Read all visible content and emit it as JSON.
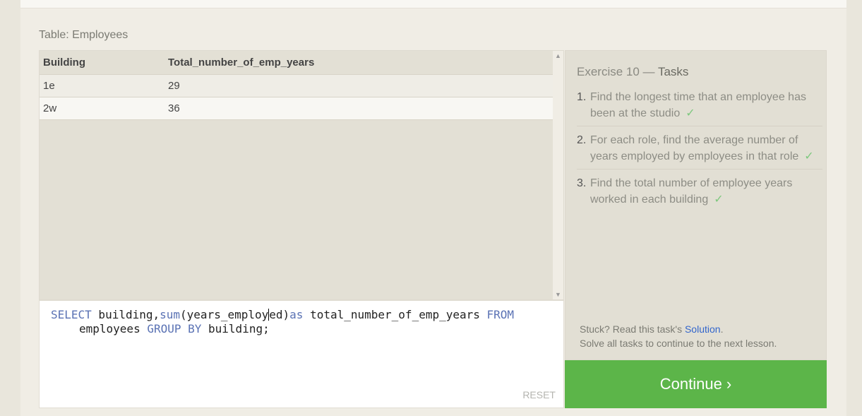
{
  "table_title": "Table: Employees",
  "results": {
    "columns": [
      "Building",
      "Total_number_of_emp_years"
    ],
    "rows": [
      [
        "1e",
        "29"
      ],
      [
        "2w",
        "36"
      ]
    ]
  },
  "editor": {
    "line1": {
      "select": "SELECT",
      "a": " building,",
      "sum": "sum",
      "b": "(years_employ",
      "c": "ed)",
      "as": "as",
      "d": " total_number_of_emp_years ",
      "from": "FROM"
    },
    "line2": {
      "a": "employees ",
      "group_by": "GROUP BY",
      "b": " building;"
    },
    "reset_label": "RESET"
  },
  "tasks": {
    "exercise_label": "Exercise 10 — ",
    "tasks_word": "Tasks",
    "items": [
      {
        "num": "1.",
        "text": "Find the longest time that an employee has been at the studio",
        "check": "✓"
      },
      {
        "num": "2.",
        "text": "For each role, find the average number of years employed by employees in that role",
        "check": "✓"
      },
      {
        "num": "3.",
        "text": "Find the total number of employee years worked in each building",
        "check": "✓"
      }
    ],
    "stuck_prefix": "Stuck? Read this task's ",
    "solution_link": "Solution",
    "stuck_suffix": ".",
    "solve_all": "Solve all tasks to continue to the next lesson."
  },
  "continue_label": "Continue ›",
  "colors": {
    "continue_bg": "#5cb549",
    "keyword": "#5a72b4",
    "link": "#3366cc",
    "check": "#7ec87e"
  }
}
